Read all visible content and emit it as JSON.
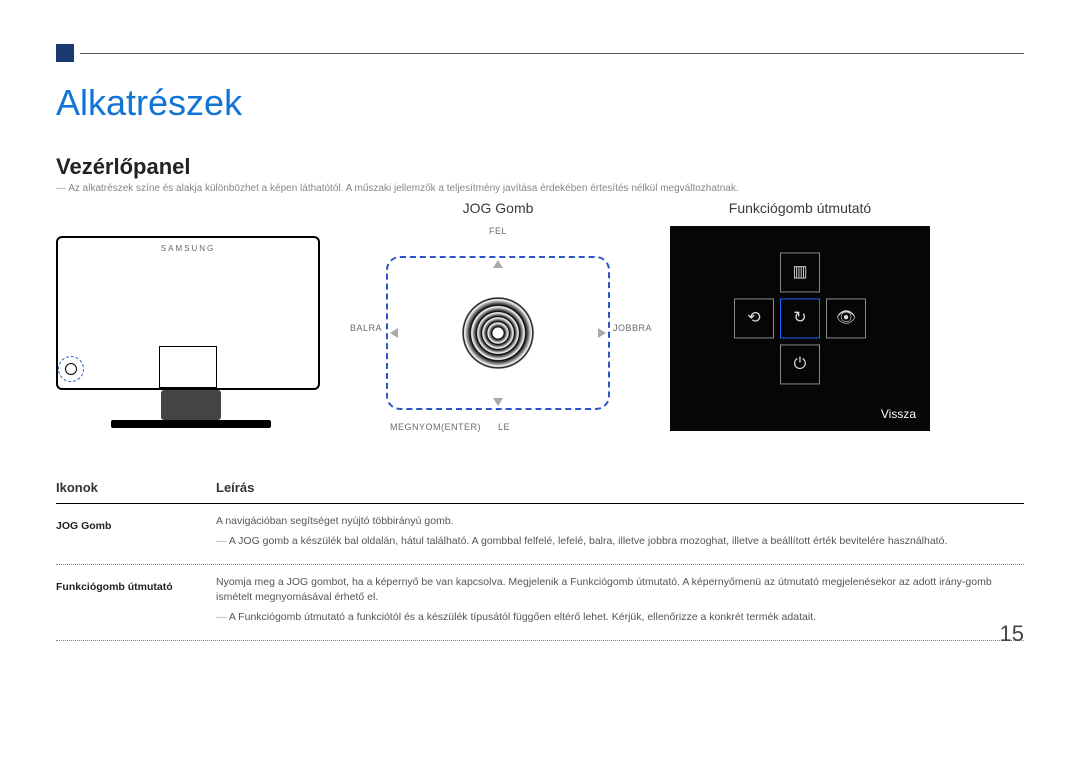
{
  "section_title": "Alkatrészek",
  "sub_title": "Vezérlőpanel",
  "disclaimer": "Az alkatrészek színe és alakja különbözhet a képen láthatótól. A műszaki jellemzők a teljesítmény javítása érdekében értesítés nélkül megváltozhatnak.",
  "fig": {
    "jog_title": "JOG Gomb",
    "func_title": "Funkciógomb útmutató",
    "labels": {
      "up": "FEL",
      "down": "LE",
      "left": "BALRA",
      "right": "JOBBRA",
      "press": "MEGNYOM(ENTER)"
    },
    "monitor_brand": "SAMSUNG",
    "osd_back": "Vissza"
  },
  "table": {
    "header_icons": "Ikonok",
    "header_desc": "Leírás",
    "rows": [
      {
        "icon": "JOG Gomb",
        "lines": [
          "A navigációban segítséget nyújtó többirányú gomb.",
          "A JOG gomb a készülék bal oldalán, hátul található. A gombbal felfelé, lefelé, balra, illetve jobbra mozoghat, illetve a beállított érték bevitelére használható."
        ],
        "dash_idx": 1
      },
      {
        "icon": "Funkciógomb útmutató",
        "lines": [
          "Nyomja meg a JOG gombot, ha a képernyő be van kapcsolva. Megjelenik a Funkciógomb útmutató. A képernyőmenü az útmutató megjelenésekor az adott irány-gomb ismételt megnyomásával érhető el.",
          "A Funkciógomb útmutató a funkciótól és a készülék típusától függően eltérő lehet. Kérjük, ellenőrizze a konkrét termék adatait."
        ],
        "dash_idx": 1
      }
    ]
  },
  "page_number": "15"
}
